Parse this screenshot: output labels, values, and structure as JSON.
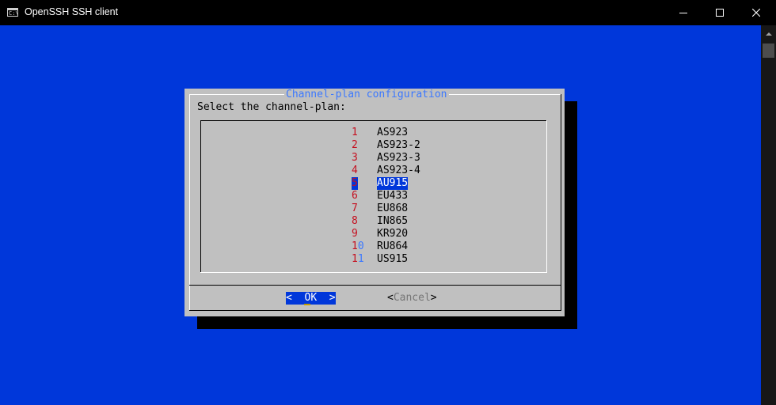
{
  "window": {
    "title": "OpenSSH SSH client",
    "icon": "console-app-icon",
    "icon_text": "C:\\"
  },
  "dialog": {
    "title": "Channel-plan configuration",
    "prompt": "Select the channel-plan:",
    "items": [
      {
        "tag": "1",
        "label": "AS923"
      },
      {
        "tag": "2",
        "label": "AS923-2"
      },
      {
        "tag": "3",
        "label": "AS923-3"
      },
      {
        "tag": "4",
        "label": "AS923-4"
      },
      {
        "tag": "5",
        "label": "AU915",
        "selected": true
      },
      {
        "tag": "6",
        "label": "EU433"
      },
      {
        "tag": "7",
        "label": "EU868"
      },
      {
        "tag": "8",
        "label": "IN865"
      },
      {
        "tag": "9",
        "label": "KR920"
      },
      {
        "tag_head": "1",
        "tag_tail": "0",
        "label": "RU864"
      },
      {
        "tag_head": "1",
        "tag_tail": "1",
        "label": "US915"
      }
    ],
    "ok_left": "<  ",
    "ok_hot": "O",
    "ok_rest": "K  >",
    "cancel_left": "<",
    "cancel_hot": "Cancel",
    "cancel_right": ">"
  },
  "colors": {
    "console_bg": "#0037da",
    "dialog_bg": "#c0c0c0",
    "title_fg": "#3b78ff",
    "tag_fg": "#c50f1f",
    "highlight": "#c19c00"
  }
}
